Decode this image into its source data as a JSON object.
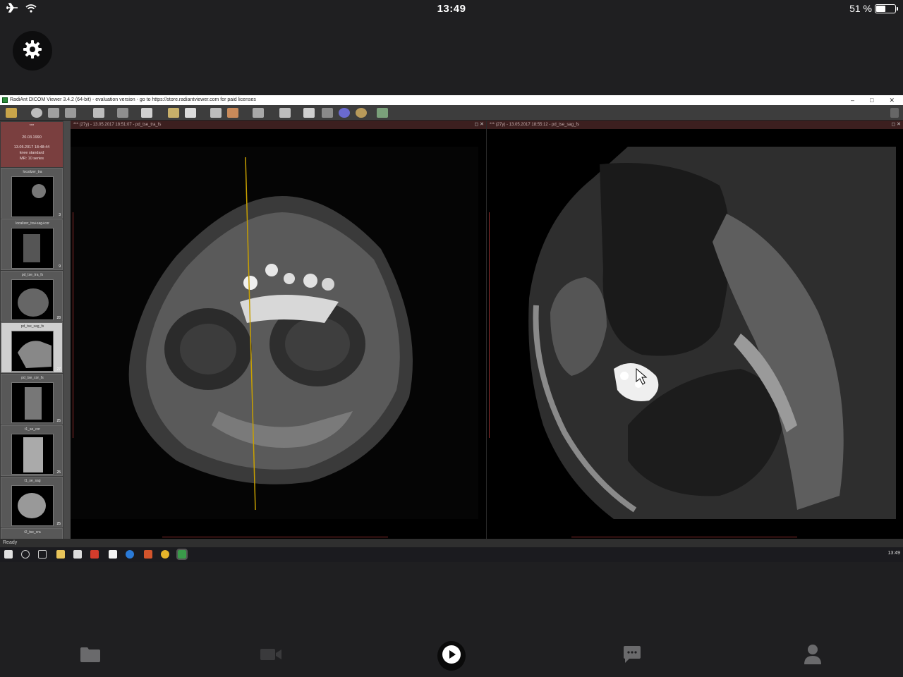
{
  "status_bar": {
    "time": "13:49",
    "battery_percent": "51 %",
    "battery_level": 0.51,
    "icons": [
      "airplane-icon",
      "wifi-icon",
      "battery-icon"
    ]
  },
  "settings_button": {
    "icon": "gear-icon"
  },
  "remote_desktop": {
    "window_title": "RadiAnt DICOM Viewer 3.4.2 (64-bit) - evaluation version - go to https://store.radiantviewer.com for paid licenses",
    "window_controls": [
      "–",
      "□",
      "✕"
    ],
    "study": {
      "patient": "***",
      "birth_date": "20.03.1990",
      "study_datetime": "13.05.2017 18:48:44",
      "description": "knee standard",
      "modality_series": "MR: 10 series"
    },
    "series": [
      {
        "label": "localizer_tra",
        "count": "3"
      },
      {
        "label": "localizer_tra+sag+cor",
        "count": "9"
      },
      {
        "label": "pd_tse_tra_fs",
        "count": "28"
      },
      {
        "label": "pd_tse_sag_fs",
        "count": "27"
      },
      {
        "label": "pd_tse_cor_fs",
        "count": "25"
      },
      {
        "label": "t1_se_cor",
        "count": "25"
      },
      {
        "label": "t1_se_sag",
        "count": "25"
      },
      {
        "label": "t2_tse_cra",
        "count": ""
      }
    ],
    "viewport_left": {
      "header": "*** (27y) - 13.05.2017 18:51:07 - pd_tse_tra_fs",
      "buttons": "◻ ✕"
    },
    "viewport_right": {
      "header": "*** (27y) - 13.05.2017 18:55:12 - pd_tse_sag_fs",
      "buttons": "◻ ✕"
    },
    "status_text": "Ready",
    "taskbar_clock": "13:49"
  },
  "tabbar": {
    "tabs": [
      {
        "name": "files",
        "icon": "folder-icon"
      },
      {
        "name": "video",
        "icon": "video-camera-icon"
      },
      {
        "name": "play",
        "icon": "play-icon"
      },
      {
        "name": "chat",
        "icon": "chat-bubble-icon"
      },
      {
        "name": "profile",
        "icon": "person-icon"
      }
    ]
  },
  "colors": {
    "background": "#1f1f21",
    "study_header": "#7a3f3f",
    "viewport_header": "#3c1f1f",
    "reference_line": "#c8a000"
  }
}
